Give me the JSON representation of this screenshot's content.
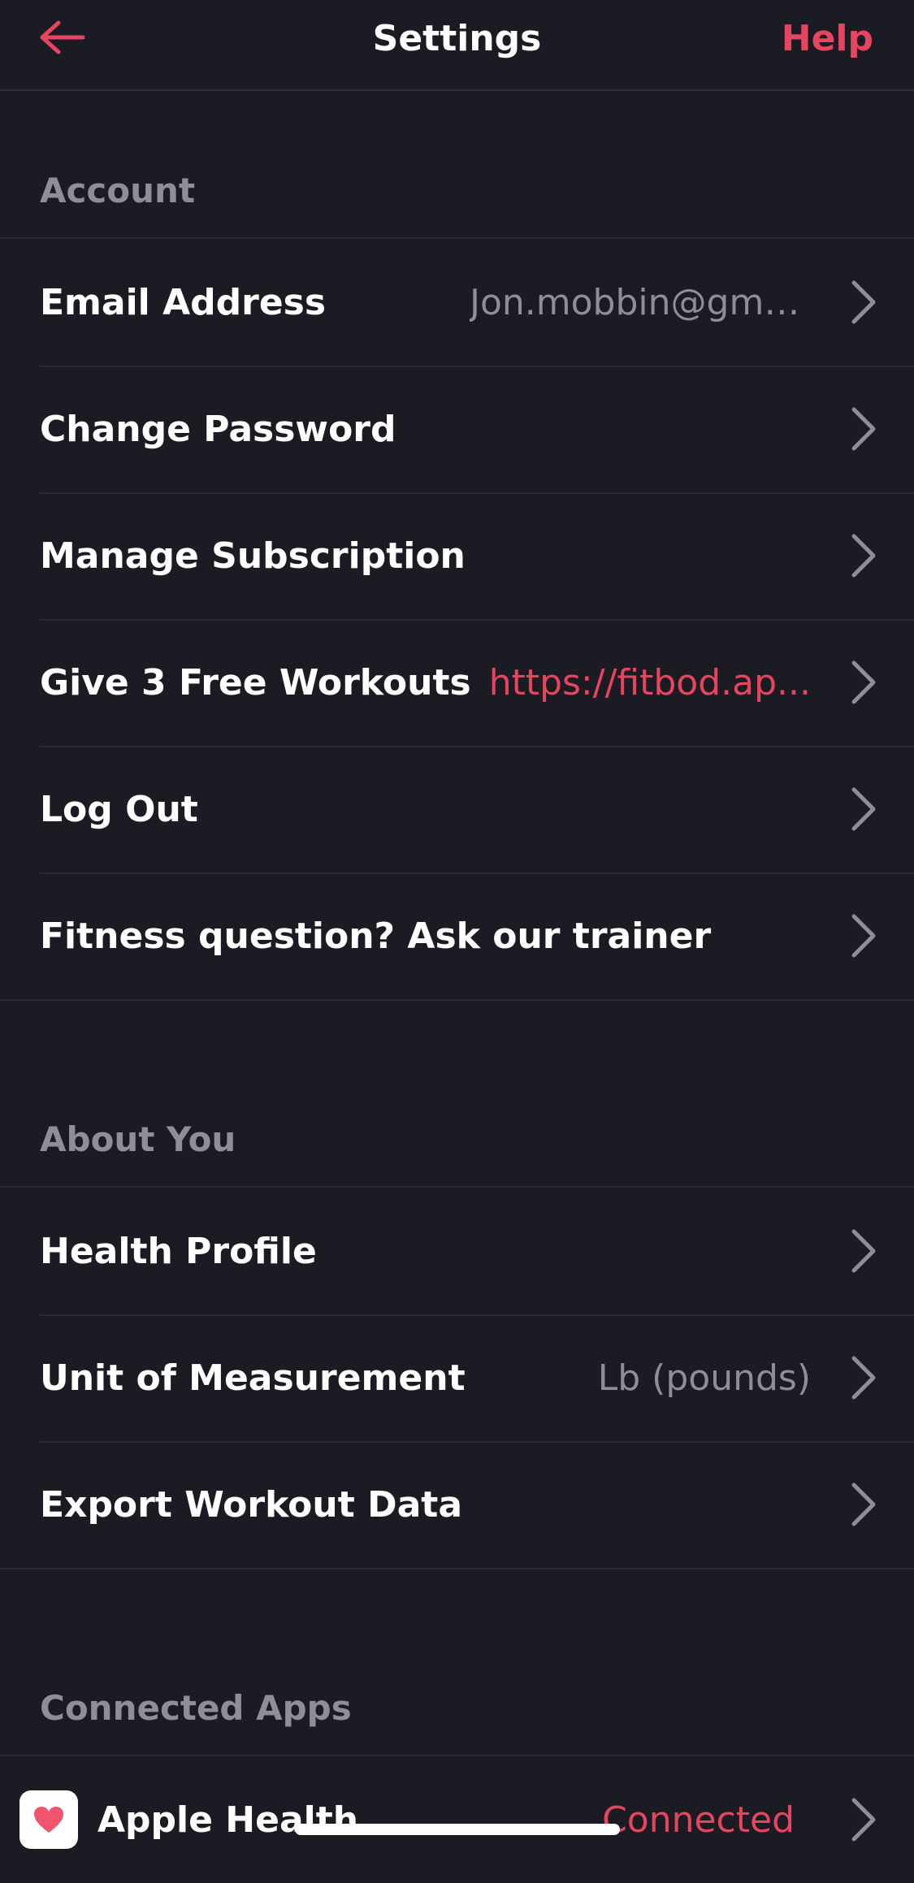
{
  "header": {
    "title": "Settings",
    "help_label": "Help"
  },
  "colors": {
    "accent": "#e5455f",
    "background": "#1b1b24",
    "muted_text": "#8e8e99",
    "divider": "#2a2a35"
  },
  "sections": {
    "account": {
      "title": "Account",
      "rows": [
        {
          "label": "Email Address",
          "value": "Jon.mobbin@gmail.com"
        },
        {
          "label": "Change Password"
        },
        {
          "label": "Manage Subscription"
        },
        {
          "label": "Give 3 Free Workouts",
          "value": "https://fitbod.ap..."
        },
        {
          "label": "Log Out"
        },
        {
          "label": "Fitness question? Ask our trainer"
        }
      ]
    },
    "about_you": {
      "title": "About You",
      "rows": [
        {
          "label": "Health Profile"
        },
        {
          "label": "Unit of Measurement",
          "value": "Lb (pounds)"
        },
        {
          "label": "Export Workout Data"
        }
      ]
    },
    "connected_apps": {
      "title": "Connected Apps",
      "rows": [
        {
          "label": "Apple Health",
          "value": "Connected",
          "icon": "heart-icon"
        }
      ]
    }
  }
}
